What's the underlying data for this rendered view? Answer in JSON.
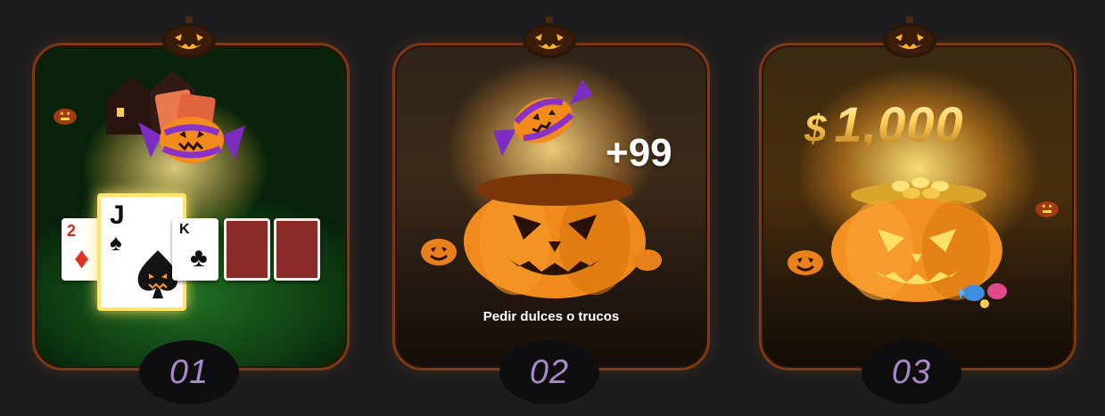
{
  "cards": [
    {
      "number": "01",
      "hand": {
        "card1_rank": "2",
        "card1_suit": "♦",
        "card2_rank": "J",
        "card2_suit": "♠",
        "card3_rank": "K",
        "card3_suit": "♣"
      }
    },
    {
      "number": "02",
      "caption": "Pedir dulces o trucos",
      "count": "+99"
    },
    {
      "number": "03",
      "prize_currency": "$",
      "prize_amount": "1,000"
    }
  ],
  "colors": {
    "number": "#a98ac9",
    "frame": "#7a3a16",
    "background": "#1c1c1e"
  },
  "icons": [
    "jack-o-lantern-icon",
    "candy-icon",
    "pumpkin-bucket-icon"
  ]
}
